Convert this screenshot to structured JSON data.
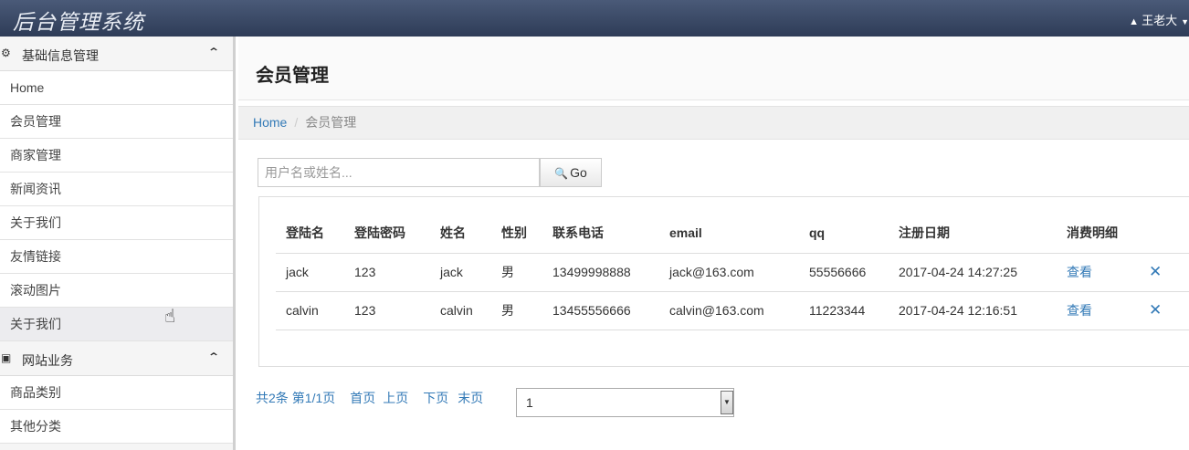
{
  "app": {
    "title": "后台管理系统"
  },
  "user": {
    "name": "王老大",
    "icon": "user-icon"
  },
  "sidebar": {
    "sections": [
      {
        "title": "基础信息管理",
        "icon": "dashboard-icon",
        "collapse_icon": "chevron-up-icon",
        "items": [
          "Home",
          "会员管理",
          "商家管理",
          "新闻资讯",
          "关于我们",
          "友情链接",
          "滚动图片",
          "关于我们"
        ]
      },
      {
        "title": "网站业务",
        "icon": "briefcase-icon",
        "collapse_icon": "chevron-up-icon",
        "items": [
          "商品类别",
          "其他分类"
        ]
      }
    ]
  },
  "page": {
    "title": "会员管理"
  },
  "breadcrumb": {
    "home": "Home",
    "sep": "/",
    "current": "会员管理"
  },
  "search": {
    "placeholder": "用户名或姓名...",
    "value": "",
    "button_label": "Go",
    "button_icon": "search-icon"
  },
  "table": {
    "headers": [
      "登陆名",
      "登陆密码",
      "姓名",
      "性别",
      "联系电话",
      "email",
      "qq",
      "注册日期",
      "消费明细"
    ],
    "rows": [
      {
        "login": "jack",
        "password": "123",
        "name": "jack",
        "gender": "男",
        "phone": "13499998888",
        "email": "jack@163.com",
        "qq": "55556666",
        "date": "2017-04-24 14:27:25",
        "detail": "查看",
        "delete": "✕"
      },
      {
        "login": "calvin",
        "password": "123",
        "name": "calvin",
        "gender": "男",
        "phone": "13455556666",
        "email": "calvin@163.com",
        "qq": "11223344",
        "date": "2017-04-24 12:16:51",
        "detail": "查看",
        "delete": "✕"
      }
    ]
  },
  "pager": {
    "total": "共2条",
    "page_info": "第1/1页",
    "first": "首页",
    "prev": "上页",
    "next": "下页",
    "last": "末页",
    "select_value": "1"
  },
  "colors": {
    "topbar": "#2e3c57",
    "link": "#337ab7"
  }
}
